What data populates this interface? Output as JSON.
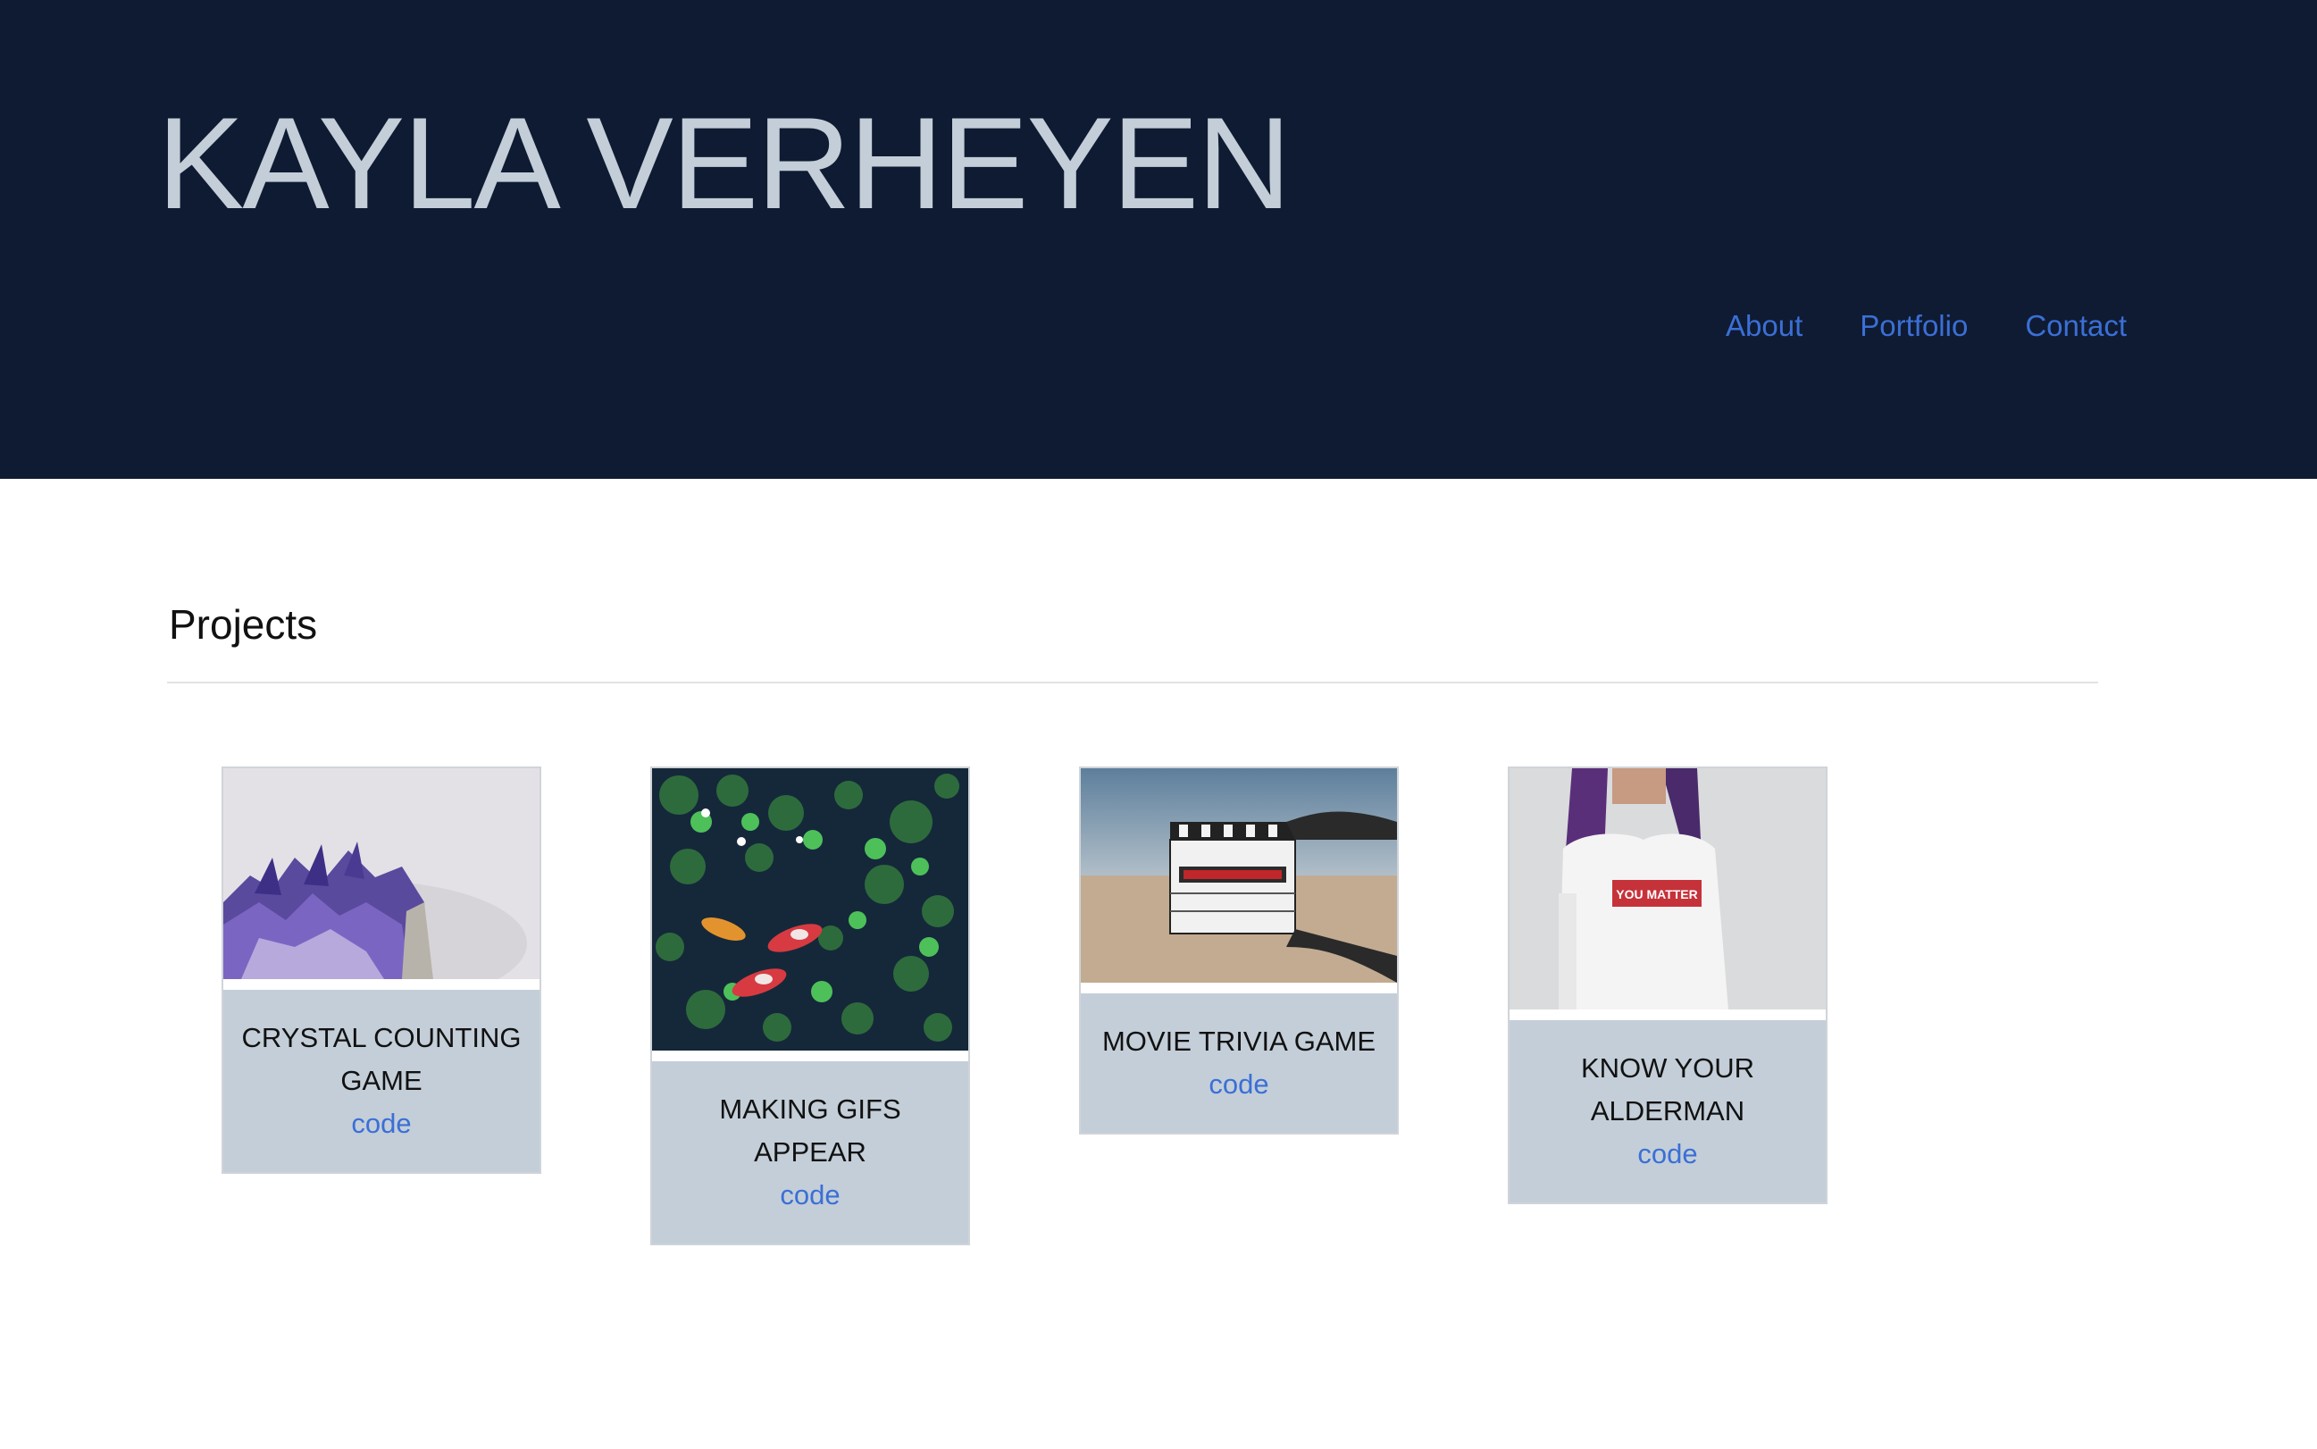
{
  "header": {
    "title": "KAYLA VERHEYEN",
    "nav": [
      "About",
      "Portfolio",
      "Contact"
    ]
  },
  "projects": {
    "heading": "Projects",
    "cards": [
      {
        "title": "CRYSTAL COUNTING GAME",
        "link": "code"
      },
      {
        "title": "MAKING GIFS APPEAR",
        "link": "code"
      },
      {
        "title": "MOVIE TRIVIA GAME",
        "link": "code"
      },
      {
        "title": "KNOW YOUR ALDERMAN",
        "link": "code"
      }
    ]
  },
  "colors": {
    "header_bg": "#0f1b32",
    "title": "#c3ced8",
    "link": "#3b6fd6",
    "card_bg": "#c3ced8"
  }
}
